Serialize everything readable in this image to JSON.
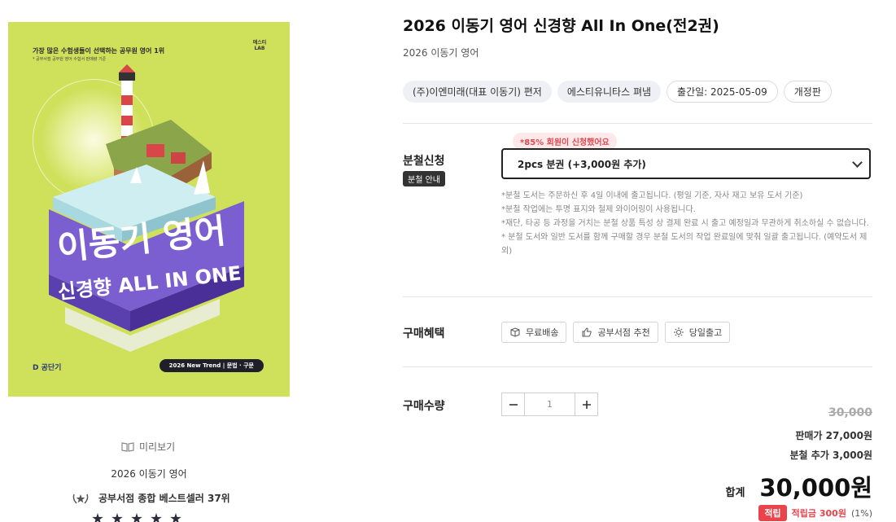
{
  "cover": {
    "tagline": "가장 많은 수험생들이 선택하는 공무원 영어 1위",
    "tagline_sub": "* 공부서점 공무원 영어 수험서 판매량 기준",
    "publisher_logo": "에스티 LAB",
    "title_main": "이동기 영어",
    "title_sub": "신경향 ALL IN ONE",
    "bottom_brand": "D 공단기",
    "badge": "2026 New Trend | 문법 · 구문",
    "bg_color": "#cfe05b"
  },
  "left": {
    "preview_label": "미리보기",
    "series": "2026 이동기 영어",
    "bestseller": "공부서점 종합 베스트셀러 37위",
    "star_count": 5
  },
  "product": {
    "title": "2026 이동기 영어 신경향 All In One(전2권)",
    "subtitle": "2026 이동기 영어",
    "tags": [
      "(주)이엔미래(대표 이동기) 편저",
      "에스티유니타스 펴냄",
      "출간일: 2025-05-09",
      "개정판"
    ]
  },
  "split": {
    "label": "분철신청",
    "guide": "분철 안내",
    "tooltip": "*85% 회원이 신청했어요",
    "selected": "2pcs 분권 (+3,000원 추가)",
    "notes": [
      "*분철 도서는 주문하신 후 4일 이내에 출고됩니다. (평일 기준, 자사 재고 보유 도서 기준)",
      "*분철 작업에는 투명 표지와 철제 와이어링이 사용됩니다.",
      "*재단, 타공 등 과정을 거치는 분철 상품 특성 상 결제 완료 시 출고 예정일과 무관하게 취소하실 수 없습니다.",
      "* 분철 도서와 일반 도서를 함께 구매할 경우 분철 도서의 작업 완료일에 맞춰 일괄 출고됩니다. (예약도서 제외)"
    ]
  },
  "benefits": {
    "label": "구매혜택",
    "items": [
      "무료배송",
      "공부서점 추천",
      "당일출고"
    ]
  },
  "quantity": {
    "label": "구매수량",
    "value": "1"
  },
  "price": {
    "original": "30,000",
    "sale": "판매가 27,000원",
    "extra": "분철 추가 3,000원",
    "total_label": "합계",
    "total": "30,000원",
    "points_badge": "적립",
    "points": "적립금 300원",
    "points_pct": "(1%)"
  }
}
